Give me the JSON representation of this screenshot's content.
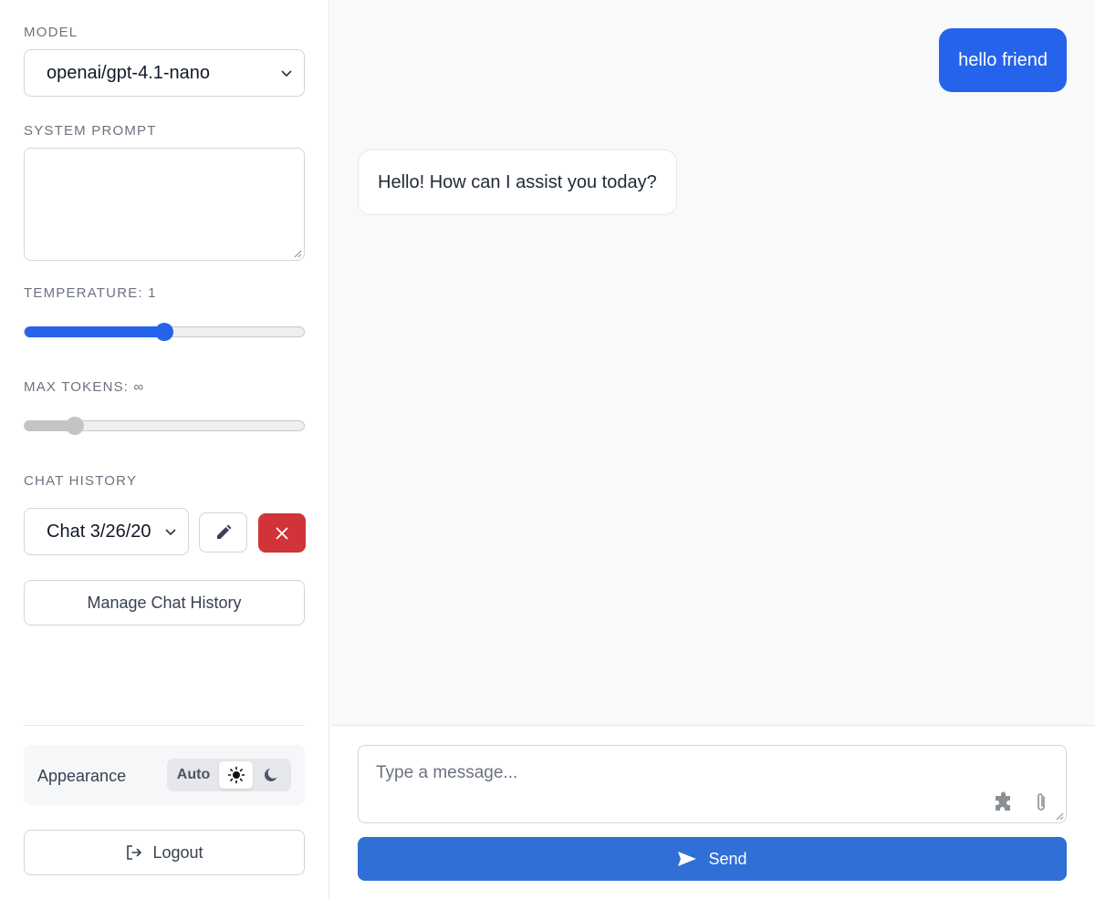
{
  "sidebar": {
    "model": {
      "label": "MODEL",
      "value": "openai/gpt-4.1-nano"
    },
    "system_prompt": {
      "label": "SYSTEM PROMPT",
      "value": ""
    },
    "temperature": {
      "label": "TEMPERATURE: 1",
      "value": 1,
      "level": 0.5,
      "accent": "#2563eb"
    },
    "max_tokens": {
      "label": "MAX TOKENS: ∞",
      "level": 0.18
    },
    "chat_history": {
      "label": "CHAT HISTORY",
      "selected": "Chat 3/26/20",
      "manage_label": "Manage Chat History",
      "edit_icon": "pencil-icon",
      "delete_icon": "close-icon",
      "delete_color": "#d13438"
    },
    "appearance": {
      "label": "Appearance",
      "options": [
        "Auto",
        "light",
        "dark"
      ],
      "auto_label": "Auto",
      "selected": "light"
    },
    "logout_label": "Logout"
  },
  "messages": [
    {
      "role": "user",
      "text": "hello friend"
    },
    {
      "role": "assistant",
      "text": "Hello! How can I assist you today?"
    }
  ],
  "composer": {
    "placeholder": "Type a message...",
    "send_label": "Send",
    "send_color": "#2f6fd6"
  }
}
